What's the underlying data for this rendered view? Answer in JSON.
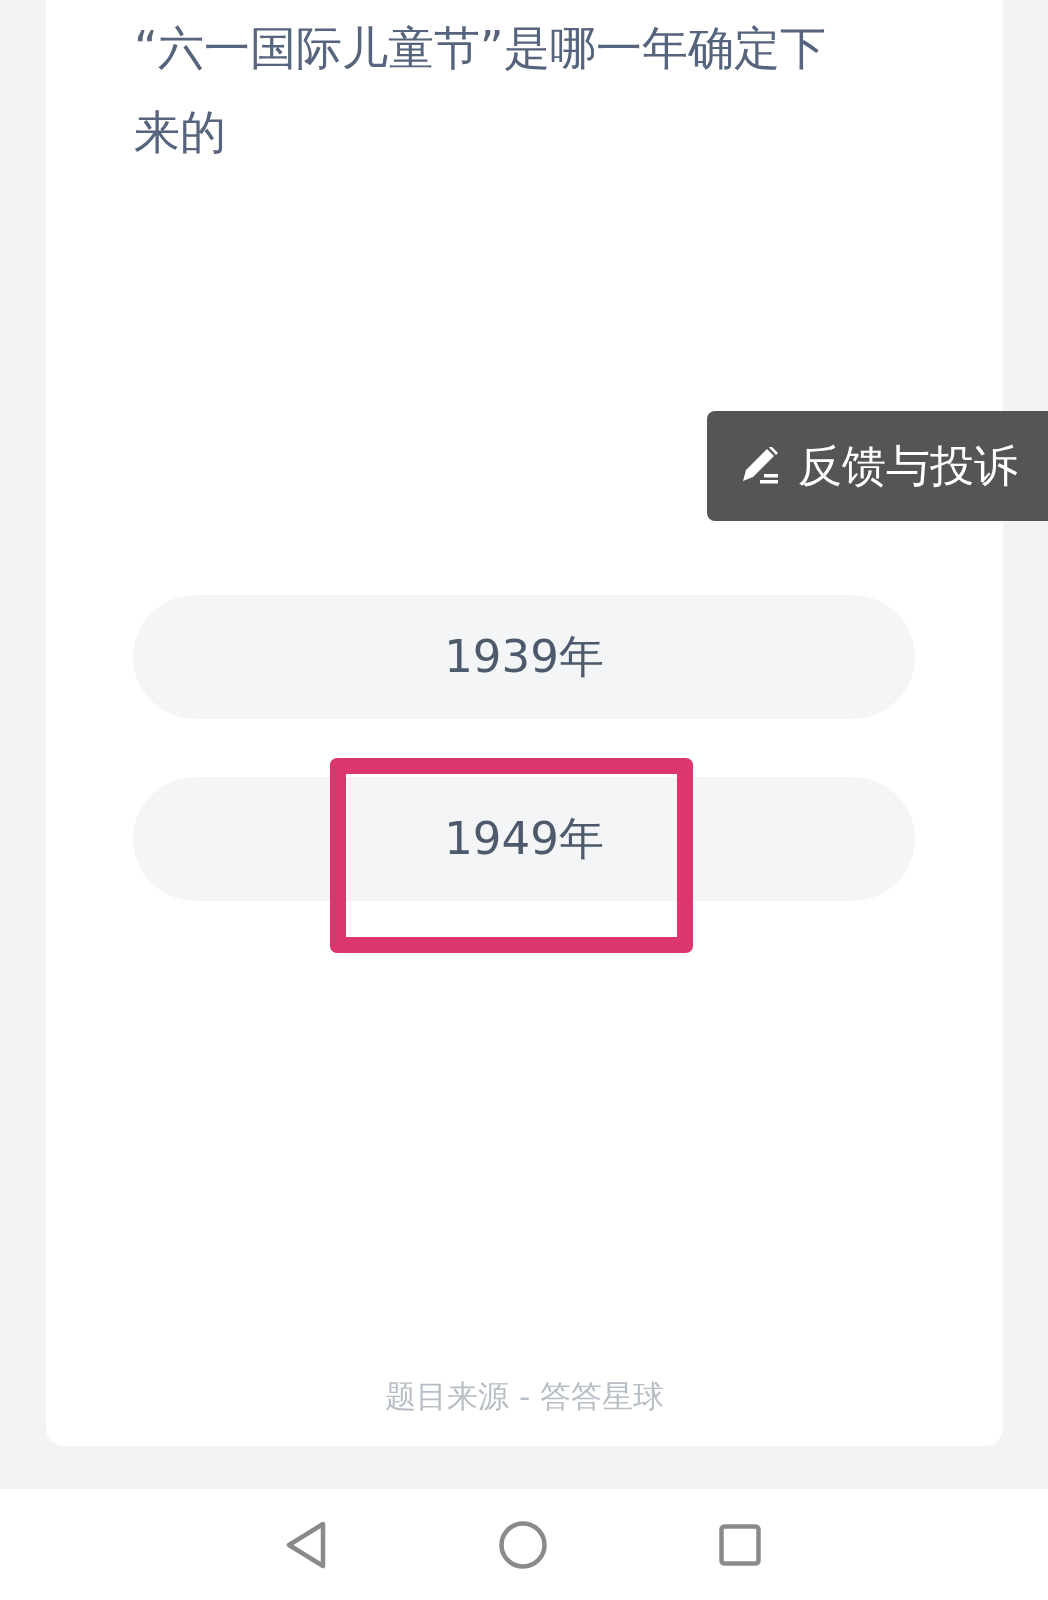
{
  "question": "“六一国际儿童节”是哪一年确定下来的",
  "feedback_button": {
    "label": "反馈与投诉"
  },
  "options": [
    {
      "label": "1939年",
      "highlighted": false
    },
    {
      "label": "1949年",
      "highlighted": true
    }
  ],
  "source": "题目来源 - 答答星球",
  "nav_bar": {
    "buttons": [
      {
        "kind": "back"
      },
      {
        "kind": "home"
      },
      {
        "kind": "recents"
      }
    ]
  }
}
